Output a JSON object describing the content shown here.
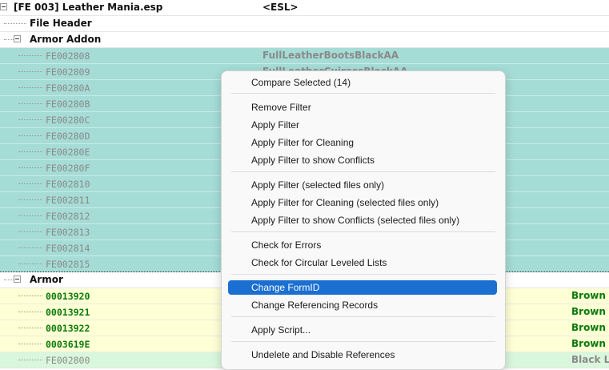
{
  "tree": {
    "root": {
      "label": "[FE 003] Leather Mania.esp",
      "value": "<ESL>"
    },
    "file_header": "File Header",
    "armor_addon": {
      "label": "Armor Addon",
      "records": [
        {
          "id": "FE002808",
          "value": "FullLeatherBootsBlackAA"
        },
        {
          "id": "FE002809",
          "value": "FullLeatherCuirassBlackAA"
        },
        {
          "id": "FE00280A",
          "value": ""
        },
        {
          "id": "FE00280B",
          "value": ""
        },
        {
          "id": "FE00280C",
          "value": ""
        },
        {
          "id": "FE00280D",
          "value": ""
        },
        {
          "id": "FE00280E",
          "value": ""
        },
        {
          "id": "FE00280F",
          "value": ""
        },
        {
          "id": "FE002810",
          "value": ""
        },
        {
          "id": "FE002811",
          "value": ""
        },
        {
          "id": "FE002812",
          "value": ""
        },
        {
          "id": "FE002813",
          "value": ""
        },
        {
          "id": "FE002814",
          "value": ""
        },
        {
          "id": "FE002815",
          "value": ""
        }
      ]
    },
    "armor": {
      "label": "Armor",
      "records": [
        {
          "id": "00013920",
          "right": "Brown Le"
        },
        {
          "id": "00013921",
          "right": "Brown Le"
        },
        {
          "id": "00013922",
          "right": "Brown Le"
        },
        {
          "id": "0003619E",
          "right": "Brown Le"
        },
        {
          "id": "FE002800",
          "right": "Black Le"
        }
      ]
    }
  },
  "context_menu": {
    "items": [
      "Compare Selected (14)",
      "Remove Filter",
      "Apply Filter",
      "Apply Filter for Cleaning",
      "Apply Filter to show Conflicts",
      "Apply Filter (selected files only)",
      "Apply Filter for Cleaning (selected files only)",
      "Apply Filter to show Conflicts (selected files only)",
      "Check for Errors",
      "Check for Circular Leveled Lists",
      "Change FormID",
      "Change Referencing Records",
      "Apply Script...",
      "Undelete and Disable References"
    ],
    "highlighted_item": "Change FormID"
  },
  "colors": {
    "selected_row": "#a5dcd6",
    "armor_row": "#ffffd6",
    "menu_highlight": "#1a6fd0",
    "override_text": "#0a7a0a"
  }
}
